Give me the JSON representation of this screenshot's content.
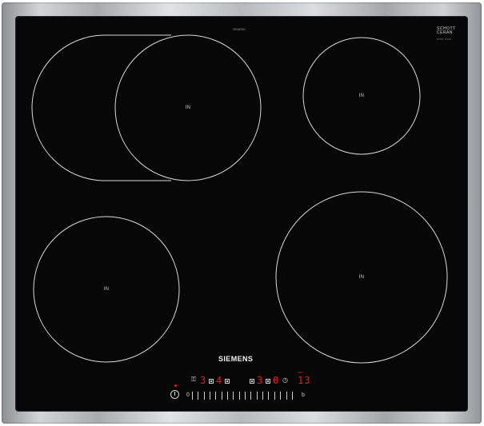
{
  "hob": {
    "brand": "SIEMENS",
    "glass_brand_line1": "SCHOTT",
    "glass_brand_line2": "CERAN",
    "glass_code": "9590 0000",
    "top_print": "SIEMENS",
    "zones": [
      {
        "id": "rear-left-dual",
        "label": "IN"
      },
      {
        "id": "rear-right",
        "label": "IN"
      },
      {
        "id": "front-left",
        "label": "IN"
      },
      {
        "id": "front-right",
        "label": "IN"
      }
    ]
  },
  "controls": {
    "zone_displays": [
      "3",
      "4",
      "3",
      "0"
    ],
    "timer_display": "13",
    "timer_unit": "min",
    "slider_start": "0",
    "slider_end": "b",
    "power_icon": "power-icon",
    "timer_icon": "clock-icon",
    "child_lock_icon": "child-lock-icon",
    "colors": {
      "glass": "#070707",
      "frame": "#b9bbbe",
      "display_red": "#e0202a",
      "zone_line": "#d9d9d9"
    }
  }
}
